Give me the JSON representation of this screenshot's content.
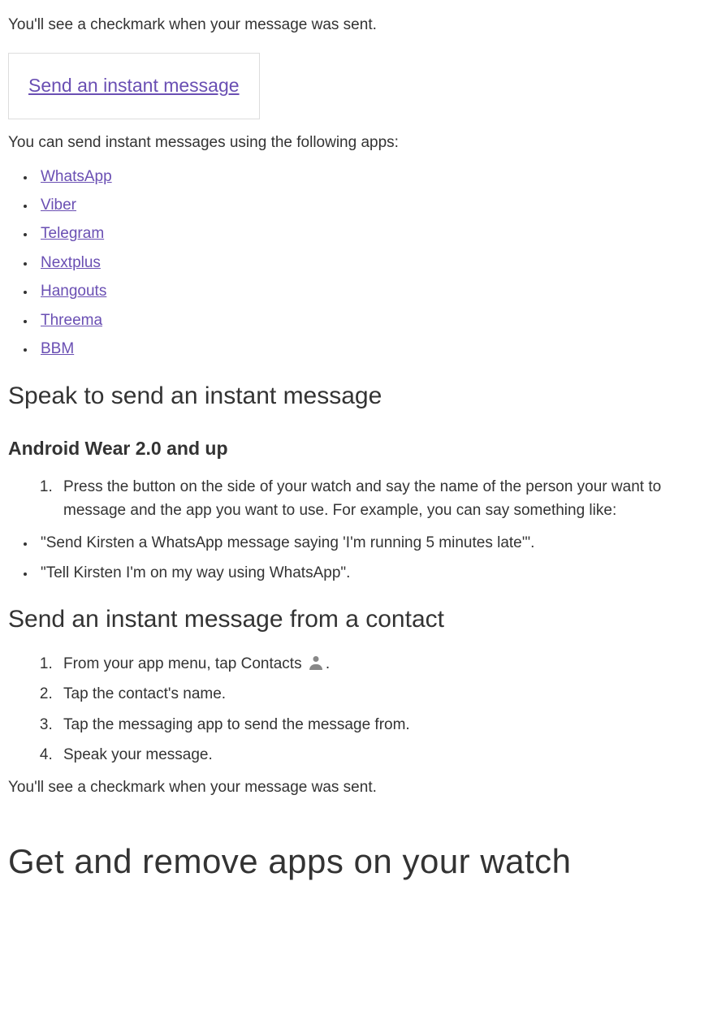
{
  "intro_sent_confirm": "You'll see a checkmark when your message was sent.",
  "box_link": "Send an instant message",
  "apps_intro": "You can send instant messages using the following apps:",
  "apps": [
    "WhatsApp",
    "Viber",
    "Telegram",
    "Nextplus",
    "Hangouts",
    "Threema",
    "BBM"
  ],
  "h2_speak": "Speak to send an instant message",
  "h3_wear": "Android Wear 2.0 and up",
  "speak_step1": "Press the button on the side of your watch and say the name of the person your want to message and the app you want to use. For example, you can say something like:",
  "speak_bullets": [
    "\"Send Kirsten a WhatsApp message saying 'I'm running 5 minutes late'\".",
    "\"Tell Kirsten I'm on my way using WhatsApp\"."
  ],
  "h2_contact": "Send an instant message from a contact",
  "contact_steps": {
    "s1a": "From your app menu, tap Contacts ",
    "s1b": ".",
    "s2": "Tap the contact's name.",
    "s3": "Tap the messaging app to send the message from.",
    "s4": "Speak your message."
  },
  "outro_sent_confirm": "You'll see a checkmark when your message was sent.",
  "h1_apps": "Get and remove apps on your watch"
}
